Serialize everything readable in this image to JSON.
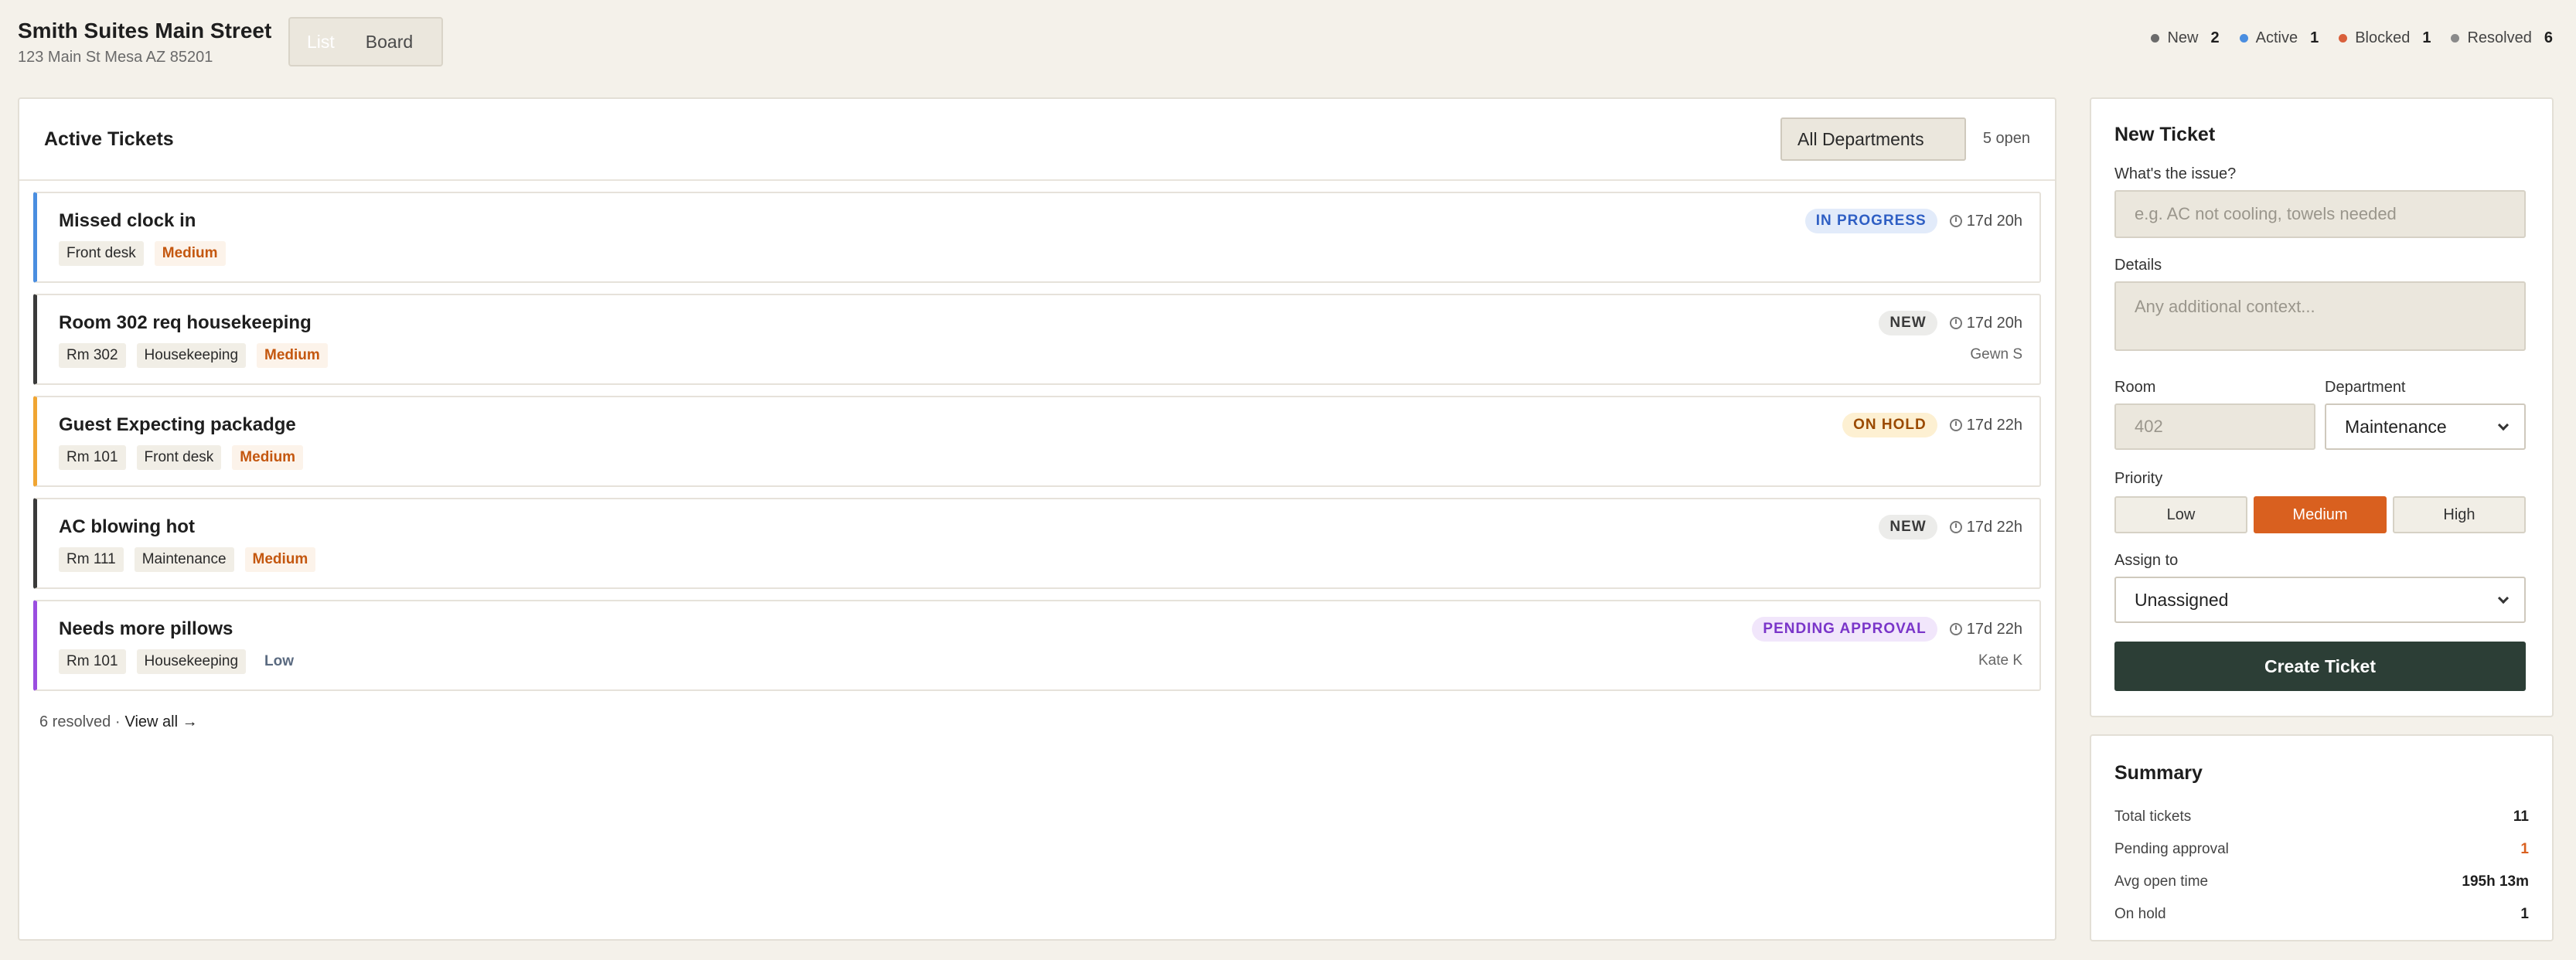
{
  "header": {
    "property_name": "Smith Suites Main Street",
    "property_address": "123 Main St Mesa AZ 85201",
    "view_toggle": {
      "list_label": "List",
      "board_label": "Board",
      "active": "list"
    },
    "status_counts": [
      {
        "label": "New",
        "count": "2",
        "color": "#6b6b6b"
      },
      {
        "label": "Active",
        "count": "1",
        "color": "#4a8ee0"
      },
      {
        "label": "Blocked",
        "count": "1",
        "color": "#d9603b"
      },
      {
        "label": "Resolved",
        "count": "6",
        "color": "#8a8a8a"
      }
    ]
  },
  "main": {
    "title": "Active Tickets",
    "department_filter": "All Departments",
    "open_count": "5 open",
    "tickets": [
      {
        "title": "Missed clock in",
        "tags": [
          "Front desk"
        ],
        "priority": "Medium",
        "status": "IN PROGRESS",
        "age": "17d 20h",
        "assignee": "",
        "accent": "#4a8ee0",
        "status_color": "#2f5fc4",
        "status_bg": "#e2ebfa"
      },
      {
        "title": "Room 302 req housekeeping",
        "tags": [
          "Rm 302",
          "Housekeeping"
        ],
        "priority": "Medium",
        "status": "NEW",
        "age": "17d 20h",
        "assignee": "Gewn S",
        "accent": "#3a3a3a",
        "status_color": "#3a3a3a",
        "status_bg": "#ececea"
      },
      {
        "title": "Guest Expecting packadge",
        "tags": [
          "Rm 101",
          "Front desk"
        ],
        "priority": "Medium",
        "status": "ON HOLD",
        "age": "17d 22h",
        "assignee": "",
        "accent": "#f0a532",
        "status_color": "#9a4a00",
        "status_bg": "#fdf0d2"
      },
      {
        "title": "AC blowing hot",
        "tags": [
          "Rm 111",
          "Maintenance"
        ],
        "priority": "Medium",
        "status": "NEW",
        "age": "17d 22h",
        "assignee": "",
        "accent": "#3a3a3a",
        "status_color": "#3a3a3a",
        "status_bg": "#ececea"
      },
      {
        "title": "Needs more pillows",
        "tags": [
          "Rm 101",
          "Housekeeping"
        ],
        "priority": "Low",
        "status": "PENDING APPROVAL",
        "age": "17d 22h",
        "assignee": "Kate K",
        "accent": "#9a4ee0",
        "status_color": "#7a35c9",
        "status_bg": "#f1e6fb"
      }
    ],
    "resolved_summary": "6 resolved ·",
    "view_all_label": "View all →",
    "priority_colors": {
      "Medium": "#c4570f",
      "Low": "#5a6a80"
    }
  },
  "new_ticket": {
    "title": "New Ticket",
    "issue_label": "What's the issue?",
    "issue_placeholder": "e.g. AC not cooling, towels needed",
    "details_label": "Details",
    "details_placeholder": "Any additional context...",
    "room_label": "Room",
    "room_placeholder": "402",
    "department_label": "Department",
    "department_value": "Maintenance",
    "priority_label": "Priority",
    "priority_options": [
      "Low",
      "Medium",
      "High"
    ],
    "priority_selected": "Medium",
    "assign_label": "Assign to",
    "assign_value": "Unassigned",
    "create_label": "Create Ticket"
  },
  "summary": {
    "title": "Summary",
    "rows": [
      {
        "label": "Total tickets",
        "value": "11",
        "color": "#1e1e1e"
      },
      {
        "label": "Pending approval",
        "value": "1",
        "color": "#d9601f"
      },
      {
        "label": "Avg open time",
        "value": "195h 13m",
        "color": "#1e1e1e"
      },
      {
        "label": "On hold",
        "value": "1",
        "color": "#1e1e1e"
      }
    ]
  }
}
